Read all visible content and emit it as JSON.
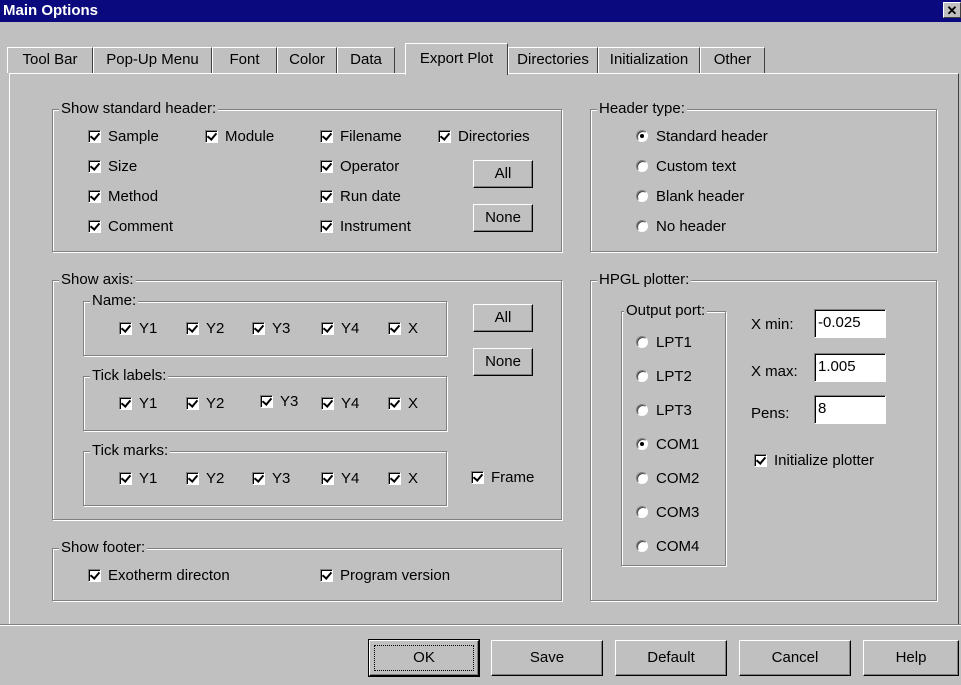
{
  "window": {
    "title": "Main Options",
    "close_glyph": "✕"
  },
  "tabs": [
    "Tool Bar",
    "Pop-Up Menu",
    "Font",
    "Color",
    "Data",
    "Export Plot",
    "Directories",
    "Initialization",
    "Other"
  ],
  "active_tab": "Export Plot",
  "show_standard_header": {
    "title": "Show standard header:",
    "sample": "Sample",
    "module": "Module",
    "filename": "Filename",
    "directories": "Directories",
    "size": "Size",
    "operator": "Operator",
    "method": "Method",
    "run_date": "Run date",
    "comment": "Comment",
    "instrument": "Instrument",
    "all_button": "All",
    "none_button": "None"
  },
  "header_type": {
    "title": "Header type:",
    "options": [
      "Standard header",
      "Custom text",
      "Blank header",
      "No header"
    ],
    "selected": "Standard header"
  },
  "show_axis": {
    "title": "Show axis:",
    "name_title": "Name:",
    "tick_labels_title": "Tick labels:",
    "tick_marks_title": "Tick marks:",
    "axes": [
      "Y1",
      "Y2",
      "Y3",
      "Y4",
      "X"
    ],
    "frame": "Frame",
    "all_button": "All",
    "none_button": "None"
  },
  "hpgl_plotter": {
    "title": "HPGL plotter:",
    "output_port_title": "Output port:",
    "ports": [
      "LPT1",
      "LPT2",
      "LPT3",
      "COM1",
      "COM2",
      "COM3",
      "COM4"
    ],
    "selected_port": "COM1",
    "xmin_label": "X min:",
    "xmin_value": "-0.025",
    "xmax_label": "X max:",
    "xmax_value": "1.005",
    "pens_label": "Pens:",
    "pens_value": "8",
    "initialize_label": "Initialize plotter"
  },
  "show_footer": {
    "title": "Show footer:",
    "exotherm": "Exotherm directon",
    "program_version": "Program version"
  },
  "buttons": {
    "ok": "OK",
    "save": "Save",
    "default": "Default",
    "cancel": "Cancel",
    "help": "Help"
  }
}
